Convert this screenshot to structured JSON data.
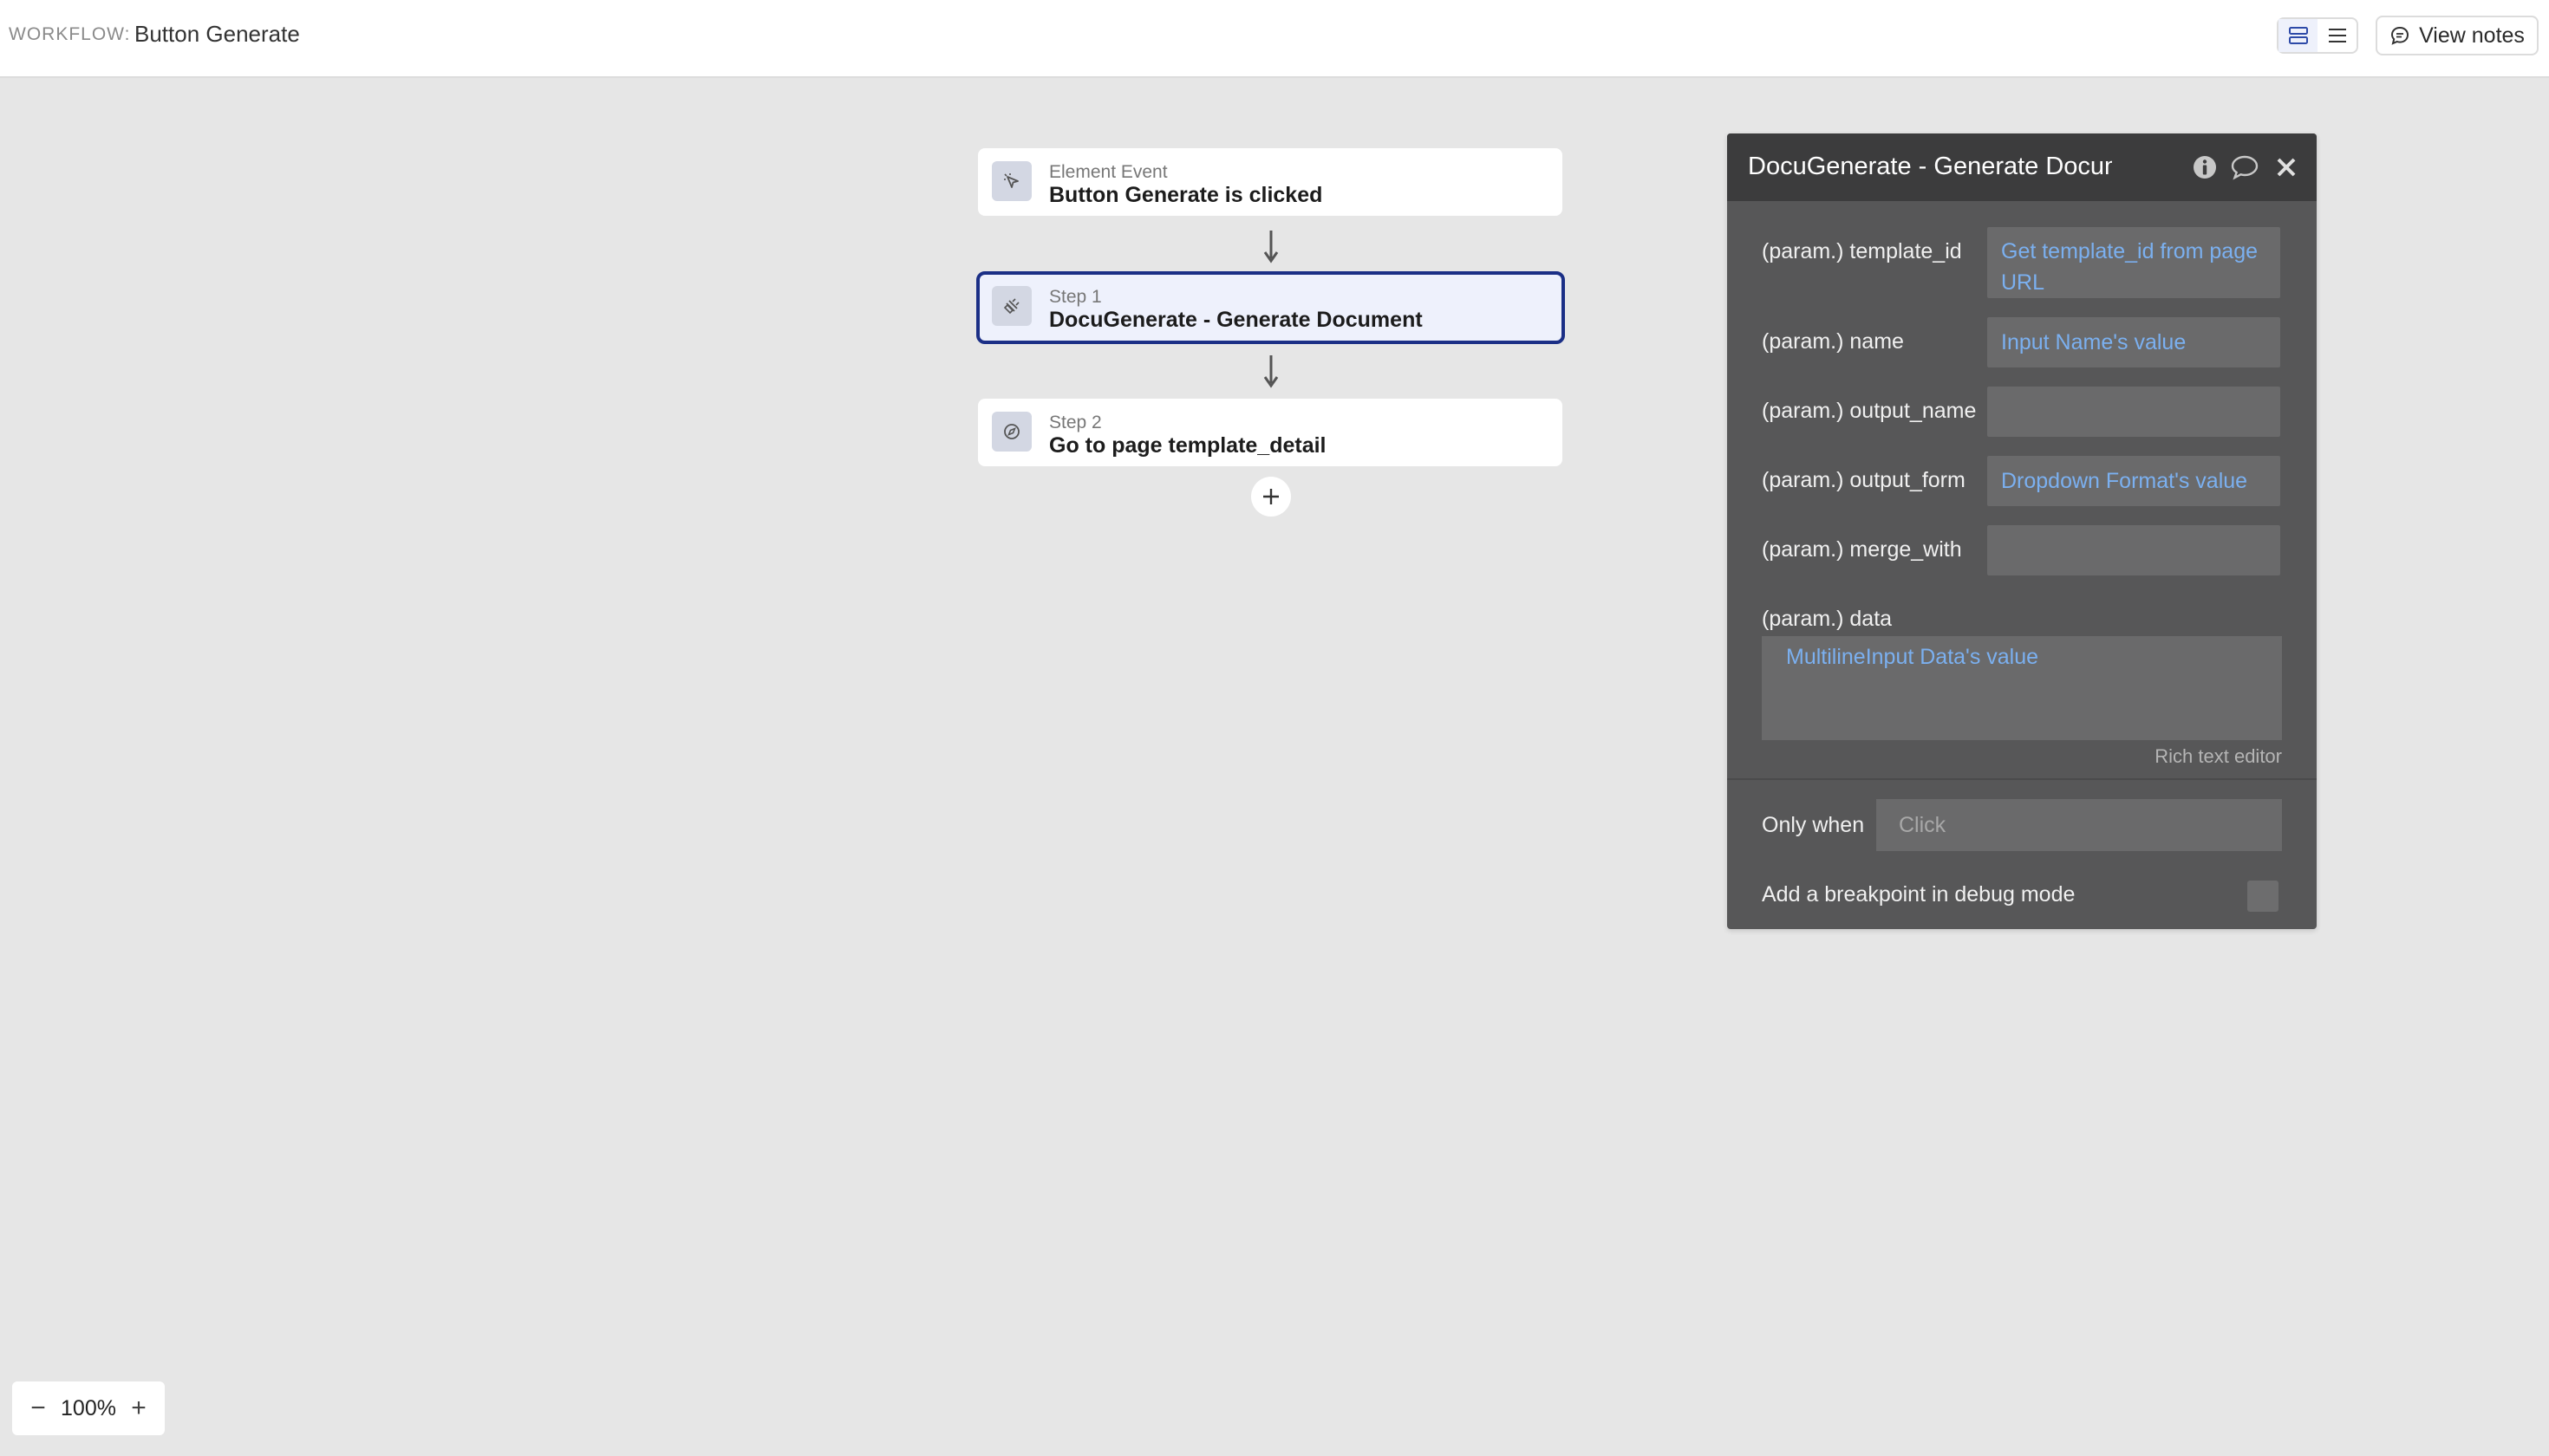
{
  "header": {
    "workflow_label": "WORKFLOW:",
    "workflow_name": "Button Generate",
    "view_notes_label": "View notes"
  },
  "workflow": {
    "event": {
      "kind": "Element Event",
      "title": "Button Generate is clicked"
    },
    "steps": [
      {
        "kind": "Step 1",
        "title": "DocuGenerate - Generate Document",
        "selected": true
      },
      {
        "kind": "Step 2",
        "title": "Go to page template_detail",
        "selected": false
      }
    ]
  },
  "panel": {
    "title": "DocuGenerate - Generate Document",
    "params": [
      {
        "label": "(param.) template_id",
        "value": "Get template_id from page URL"
      },
      {
        "label": "(param.) name",
        "value": "Input Name's value"
      },
      {
        "label": "(param.) output_name",
        "value": ""
      },
      {
        "label": "(param.) output_form",
        "value": "Dropdown Format's value"
      },
      {
        "label": "(param.) merge_with",
        "value": ""
      }
    ],
    "data_label": "(param.) data",
    "data_value": "MultilineInput Data's value",
    "rich_text_editor": "Rich text editor",
    "only_when_label": "Only when",
    "only_when_placeholder": "Click",
    "breakpoint_label": "Add a breakpoint in debug mode"
  },
  "zoom": {
    "level": "100%"
  },
  "colors": {
    "accent": "#1b2f86",
    "link": "#7bb0f0",
    "panel": "#575758",
    "panel_header": "#3c3c3d"
  }
}
